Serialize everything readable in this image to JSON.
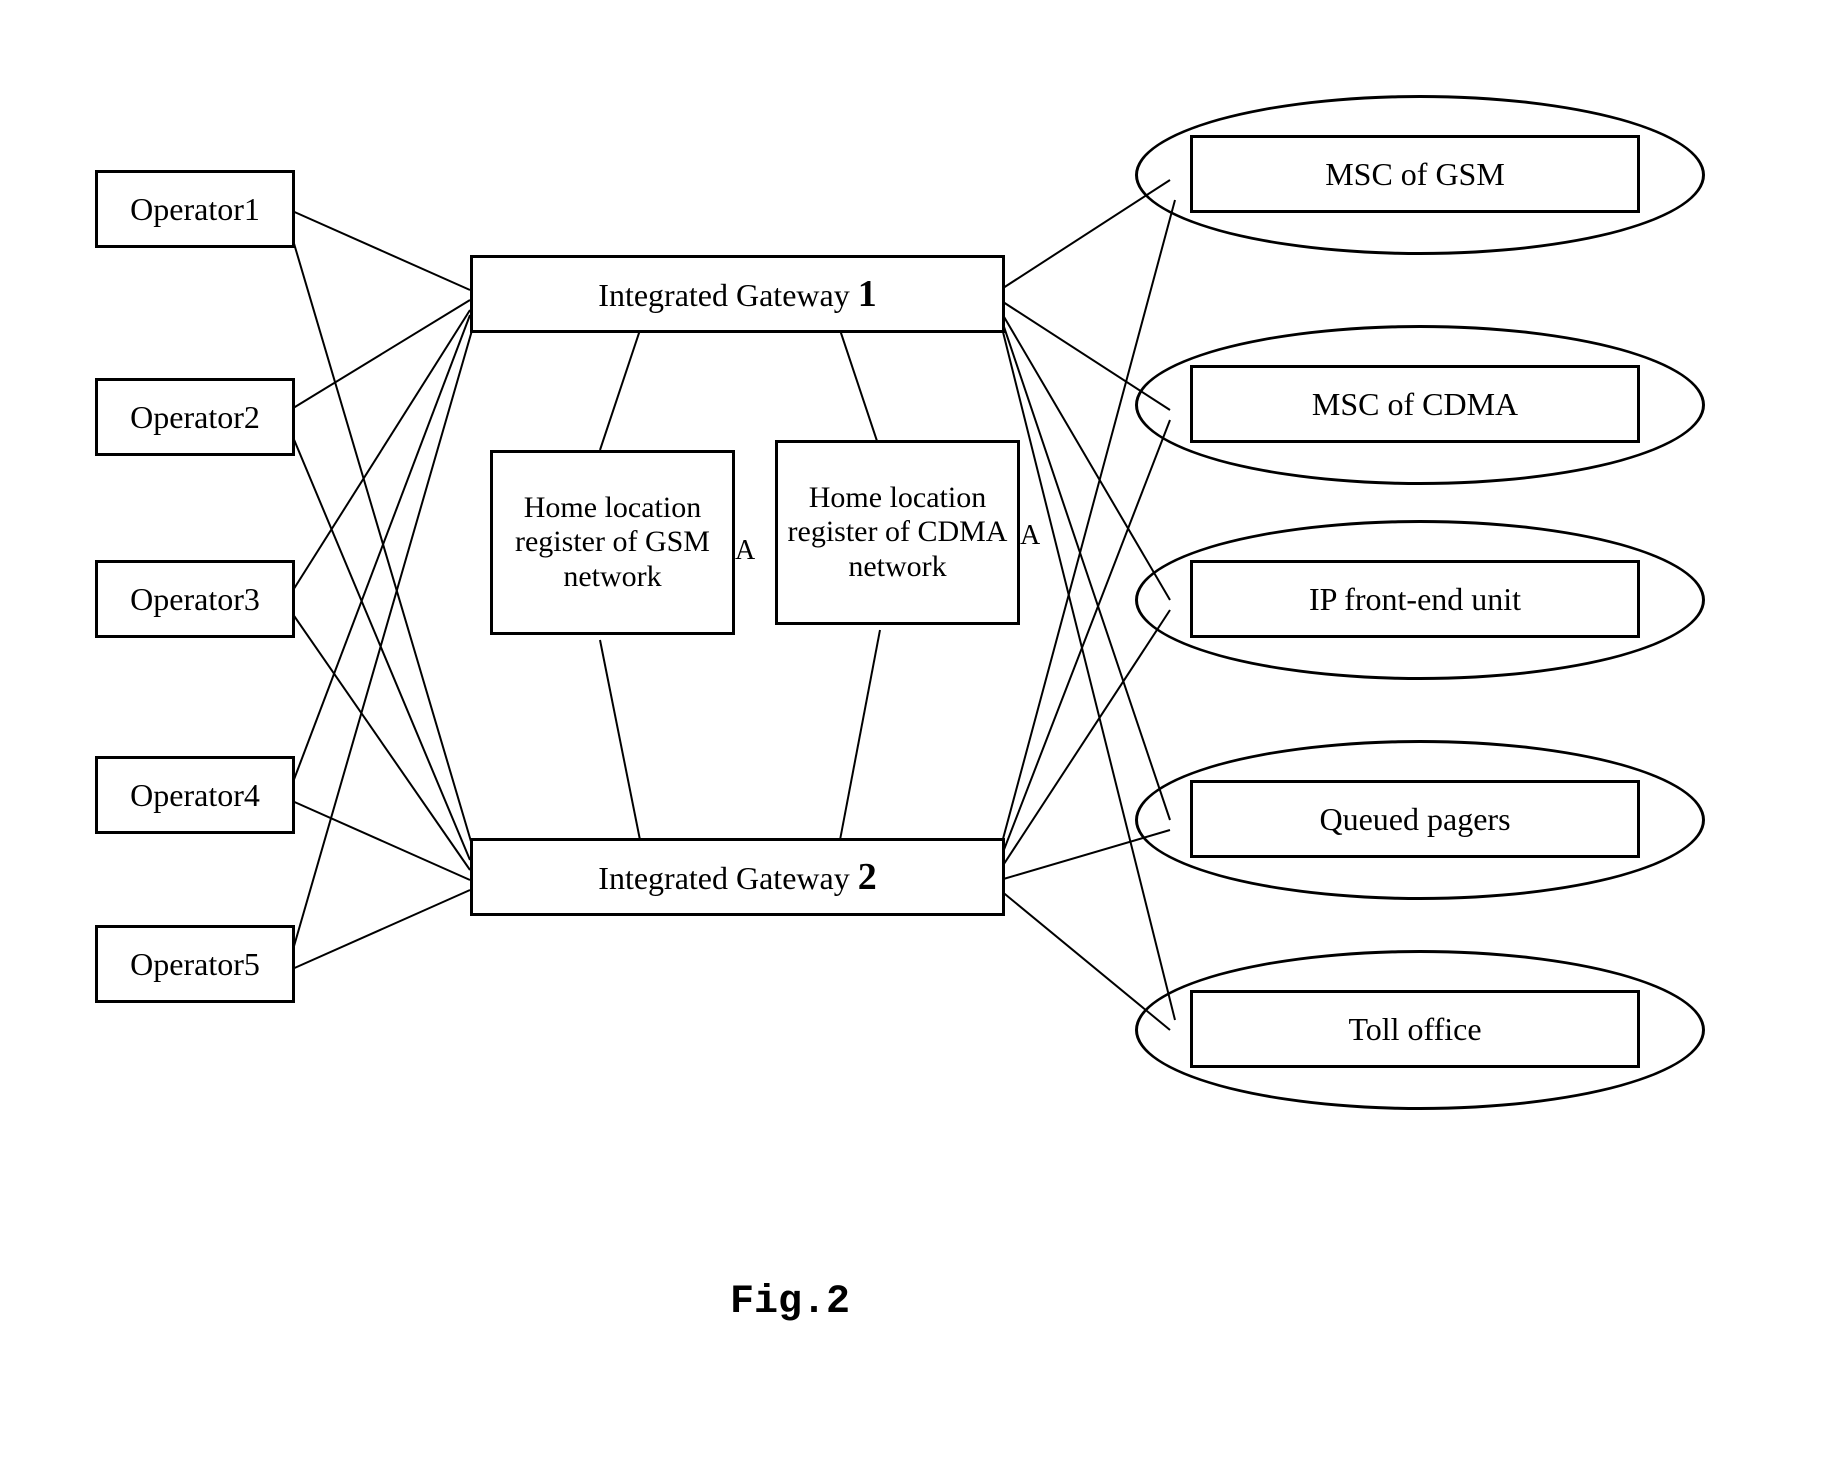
{
  "caption": "Fig.2",
  "operators": {
    "op1": "Operator1",
    "op2": "Operator2",
    "op3": "Operator3",
    "op4": "Operator4",
    "op5": "Operator5"
  },
  "gateways": {
    "gw1_label": "Integrated Gateway",
    "gw1_num": "1",
    "gw2_label": "Integrated Gateway",
    "gw2_num": "2"
  },
  "hlr": {
    "gsm": "Home location register of GSM network",
    "cdma": "Home location register of CDMA network",
    "anno_a1": "A",
    "anno_a2": "A"
  },
  "right": {
    "msc_gsm": "MSC of GSM",
    "msc_cdma": "MSC of CDMA",
    "ip_front": "IP front-end unit",
    "queued": "Queued pagers",
    "toll": "Toll office"
  }
}
